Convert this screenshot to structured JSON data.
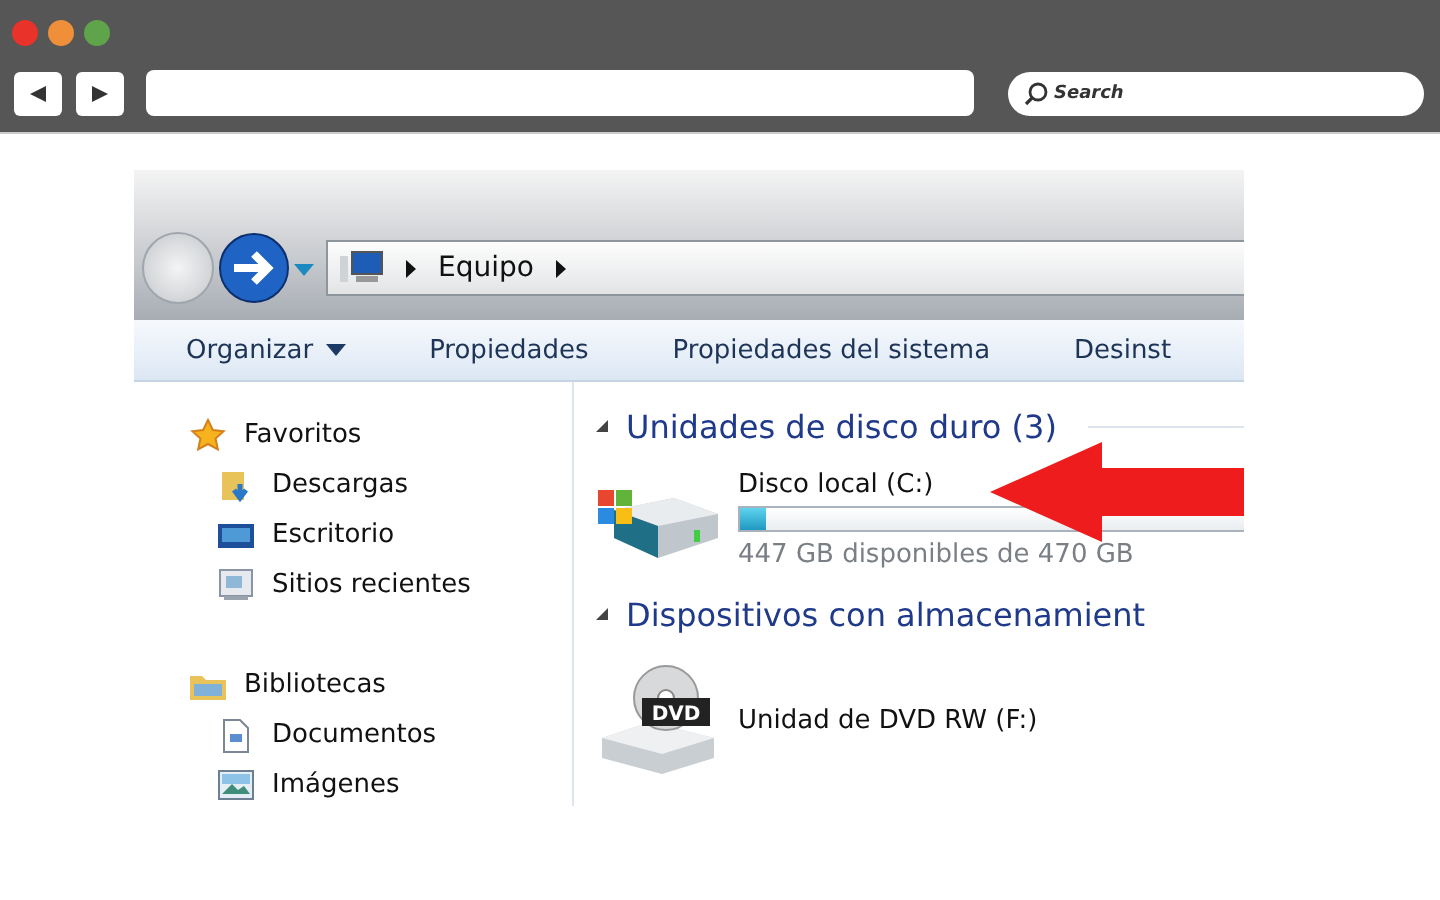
{
  "browser": {
    "search": {
      "placeholder": "Search"
    }
  },
  "explorer": {
    "breadcrumb": [
      "Equipo"
    ],
    "commands": [
      {
        "label": "Organizar",
        "has_menu": true
      },
      {
        "label": "Propiedades",
        "has_menu": false
      },
      {
        "label": "Propiedades del sistema",
        "has_menu": false
      },
      {
        "label": "Desinst",
        "has_menu": false
      }
    ],
    "sidebar": [
      {
        "label": "Favoritos",
        "children": [
          {
            "label": "Descargas"
          },
          {
            "label": "Escritorio"
          },
          {
            "label": "Sitios recientes"
          }
        ]
      },
      {
        "label": "Bibliotecas",
        "children": [
          {
            "label": "Documentos"
          },
          {
            "label": "Imágenes"
          }
        ]
      }
    ],
    "groups": [
      {
        "title": "Unidades de disco duro (3)",
        "expanded": true,
        "items": [
          {
            "kind": "disk",
            "name": "Disco local (C:)",
            "level": 0.05,
            "detail": "447 GB disponibles de 470 GB"
          }
        ]
      },
      {
        "title": "Dispositivos con almacenamient",
        "expanded": true,
        "items": [
          {
            "kind": "dvd",
            "name": "Unidad de DVD RW (F:)",
            "badge": "DVD"
          }
        ]
      }
    ]
  }
}
